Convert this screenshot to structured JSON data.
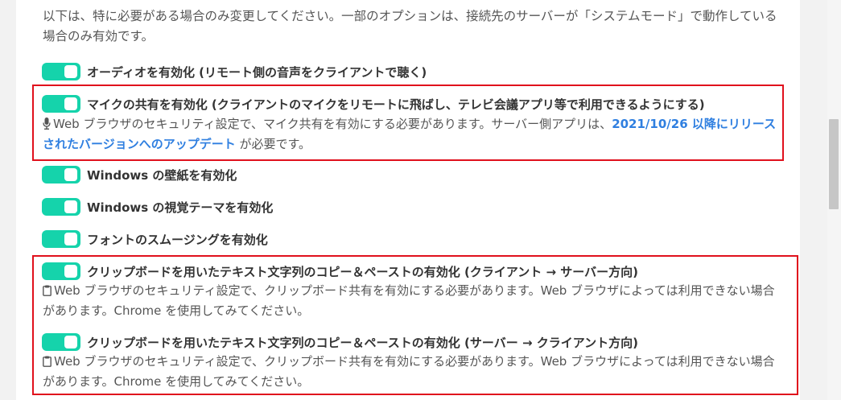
{
  "intro": {
    "text": "以下は、特に必要がある場合のみ変更してください。一部のオプションは、接続先のサーバーが「システムモード」で動作している場合のみ有効です。"
  },
  "options": {
    "audio": {
      "label": "オーディオを有効化 (リモート側の音声をクライアントで聴く)",
      "enabled": true
    },
    "mic": {
      "label": "マイクの共有を有効化 (クライアントのマイクをリモートに飛ばし、テレビ会議アプリ等で利用できるようにする)",
      "enabled": true,
      "note_prefix": "Web ブラウザのセキュリティ設定で、マイク共有を有効にする必要があります。サーバー側アプリは、",
      "note_link": "2021/10/26 以降にリリースされたバージョンへのアップデート",
      "note_suffix": " が必要です。",
      "note_icon": "microphone-icon"
    },
    "wallpaper": {
      "label": "Windows の壁紙を有効化",
      "enabled": true
    },
    "theme": {
      "label": "Windows の視覚テーマを有効化",
      "enabled": true
    },
    "font_smoothing": {
      "label": "フォントのスムージングを有効化",
      "enabled": true
    },
    "clipboard_c2s": {
      "label": "クリップボードを用いたテキスト文字列のコピー＆ペーストの有効化 (クライアント → サーバー方向)",
      "enabled": true,
      "note": "Web ブラウザのセキュリティ設定で、クリップボード共有を有効にする必要があります。Web ブラウザによっては利用できない場合があります。Chrome を使用してみてください。",
      "note_icon": "clipboard-icon"
    },
    "clipboard_s2c": {
      "label": "クリップボードを用いたテキスト文字列のコピー＆ペーストの有効化 (サーバー → クライアント方向)",
      "enabled": true,
      "note": "Web ブラウザのセキュリティ設定で、クリップボード共有を有効にする必要があります。Web ブラウザによっては利用できない場合があります。Chrome を使用してみてください。",
      "note_icon": "clipboard-icon"
    }
  },
  "colors": {
    "toggle_on": "#15d3ab",
    "link": "#2f7fe0",
    "highlight_border": "#e0101c"
  }
}
